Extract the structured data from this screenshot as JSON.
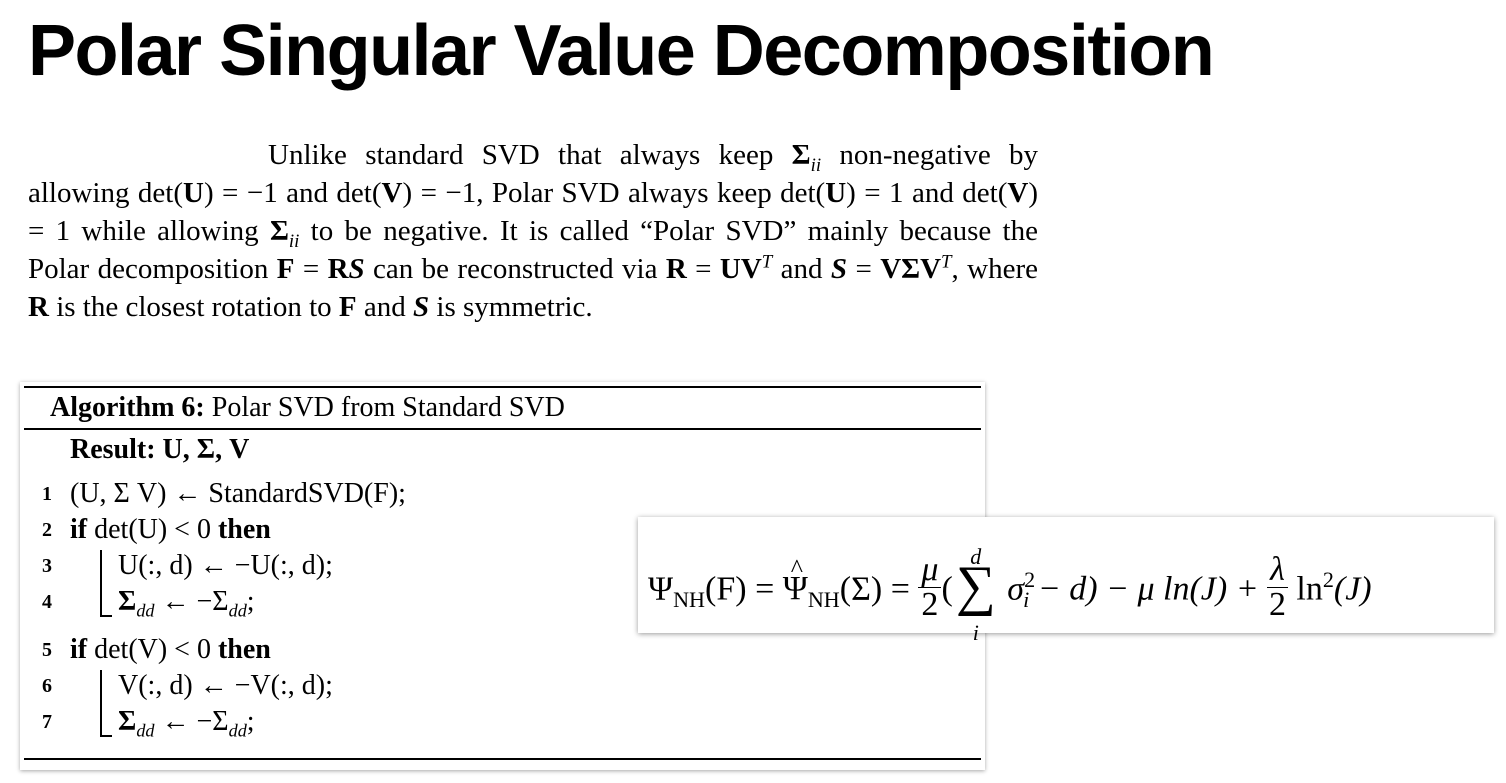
{
  "title": "Polar Singular Value Decomposition",
  "paragraph": {
    "t1": "Unlike standard SVD that always keep ",
    "sigma": "Σ",
    "ii": "ii",
    "t2": " non-negative by allowing det(",
    "U": "U",
    "t3": ") = −1 and det(",
    "V": "V",
    "t4": ") = −1, Polar SVD always keep det(",
    "t5": ") = 1 and det(",
    "t6": ") = 1 while allowing ",
    "t7": " to be negative. It is called “Polar SVD” mainly because the Polar decomposition ",
    "F": "F",
    "t8": " = ",
    "R": "R",
    "S": "S",
    "t9": " can be reconstructed via ",
    "t10": " = ",
    "UV": "UV",
    "T": "T",
    "t11": " and ",
    "t12": " = ",
    "VSV": "VΣV",
    "t13": ", where ",
    "t14": " is the closest rotation to ",
    "t15": " and ",
    "t16": " is symmetric."
  },
  "algorithm": {
    "label": "Algorithm 6:",
    "name": " Polar SVD from Standard SVD",
    "result_label": "Result:",
    "result_value": " U, Σ, V",
    "lines": [
      {
        "num": "1",
        "text": "(U, Σ V) ← StandardSVD(F);"
      },
      {
        "num": "2",
        "kw1": "if",
        "text": " det(U) < 0 ",
        "kw2": "then"
      },
      {
        "num": "3",
        "text": "U(:, d) ← −U(:, d);"
      },
      {
        "num": "4",
        "text": "Σ",
        "sub": "dd",
        "text2": " ← −Σ",
        "sub2": "dd",
        "text3": ";"
      },
      {
        "num": "5",
        "kw1": "if",
        "text": " det(V) < 0 ",
        "kw2": "then"
      },
      {
        "num": "6",
        "text": "V(:, d) ← −V(:, d);"
      },
      {
        "num": "7",
        "text": "Σ",
        "sub": "dd",
        "text2": " ← −Σ",
        "sub2": "dd",
        "text3": ";"
      }
    ]
  },
  "formula": {
    "psi": "Ψ",
    "nh": "NH",
    "f_arg": "(F) = ",
    "psi_hat": "Ψ",
    "hat": "^",
    "sigma_arg": "(Σ) = ",
    "mu": "μ",
    "two": "2",
    "open": "(",
    "sum": "∑",
    "sum_sup": "d",
    "sum_sub": "i",
    "sigma_i": "σ",
    "sq_sup": "2",
    "i_sub": "i",
    "minus_d": " − d) − μ ln(J) + ",
    "lambda": "λ",
    "ln2": " ln",
    "ln2_sup": "2",
    "j": "(J)"
  }
}
